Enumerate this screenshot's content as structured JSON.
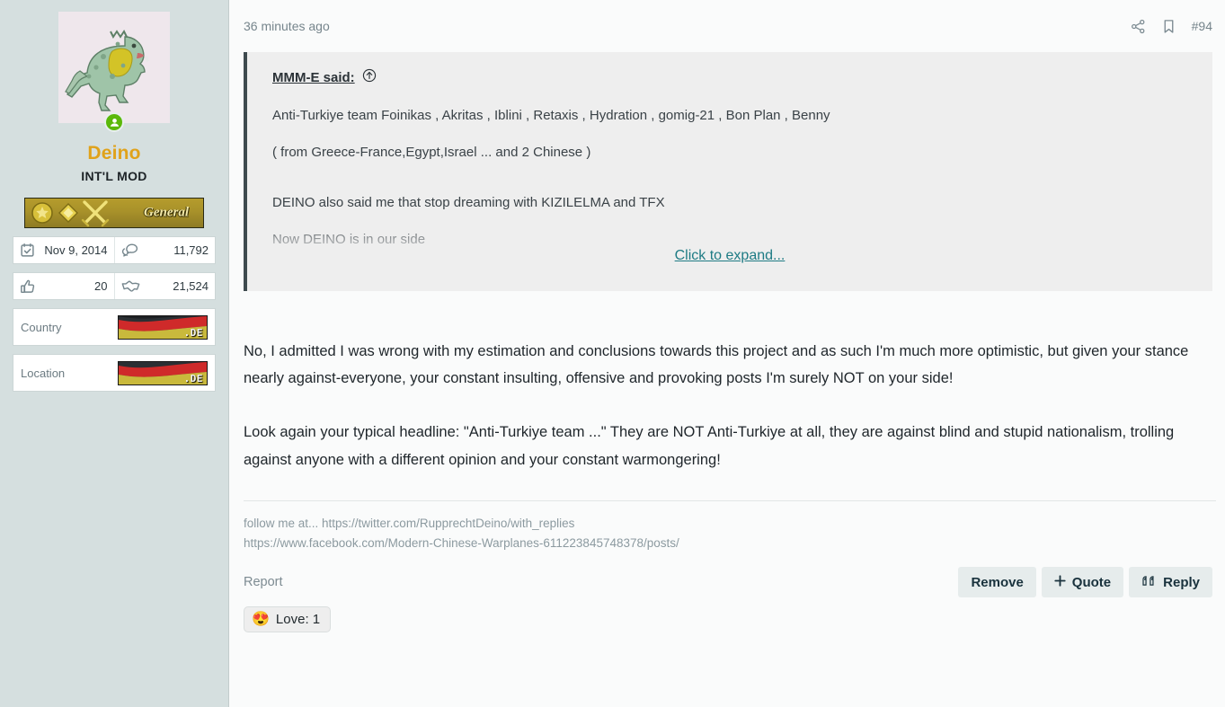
{
  "sidebar": {
    "avatar_alt": "dinosaur-avatar",
    "online_status": "online",
    "username": "Deino",
    "user_title": "INT'L MOD",
    "rank": {
      "label": "General",
      "icons": [
        "star-medal-icon",
        "diamond-icon",
        "crossed-swords-icon"
      ]
    },
    "stats": [
      {
        "icon": "calendar-check-icon",
        "value": "Nov 9, 2014"
      },
      {
        "icon": "messages-icon",
        "value": "11,792"
      },
      {
        "icon": "thumbs-up-icon",
        "value": "20"
      },
      {
        "icon": "handshake-icon",
        "value": "21,524"
      }
    ],
    "info": [
      {
        "label": "Country",
        "flag": "germany-flag",
        "tld": ".DE"
      },
      {
        "label": "Location",
        "flag": "germany-flag",
        "tld": ".DE"
      }
    ]
  },
  "header": {
    "date": "36 minutes ago",
    "share_icon": "share-icon",
    "bookmark_icon": "bookmark-icon",
    "post_number": "#94"
  },
  "quote": {
    "attribution": "MMM-E said:",
    "jump_icon": "circle-up-arrow-icon",
    "line1": "Anti-Turkiye team Foinikas , Akritas , Iblini , Retaxis , Hydration , gomig-21 , Bon Plan , Benny",
    "line2": "( from Greece-France,Egypt,Israel ... and 2 Chinese )",
    "line3": "DEINO also said me that stop dreaming with KIZILELMA and TFX",
    "line4": "Now DEINO is in our side",
    "expand_label": "Click to expand..."
  },
  "body": {
    "paragraph1": "No, I admitted I was wrong with my estimation and conclusions towards this project and as such I'm much more optimistic, but given your stance nearly against-everyone, your constant insulting, offensive and provoking posts I'm surely NOT on your side!",
    "paragraph2": "Look again your typical headline: \"Anti-Turkiye team ...\" They are NOT Anti-Turkiye at all, they are against blind and stupid nationalism, trolling against anyone with a different opinion and your constant warmongering!"
  },
  "signature": {
    "line1": "follow me at... https://twitter.com/RupprechtDeino/with_replies",
    "line2": "https://www.facebook.com/Modern-Chinese-Warplanes-611223845748378/posts/"
  },
  "actions": {
    "report_label": "Report",
    "remove_label": "Remove",
    "quote_label": "Quote",
    "quote_icon": "plus-icon",
    "reply_label": "Reply",
    "reply_icon": "quote-marks-icon"
  },
  "reactions": [
    {
      "emoji": "😍",
      "label": "Love: 1"
    }
  ],
  "colors": {
    "sidebar_bg": "#d5dfdf",
    "username": "#e0a21a",
    "link": "#1e7b84",
    "quote_border": "#3e4a4e",
    "online": "#5bb80a"
  }
}
